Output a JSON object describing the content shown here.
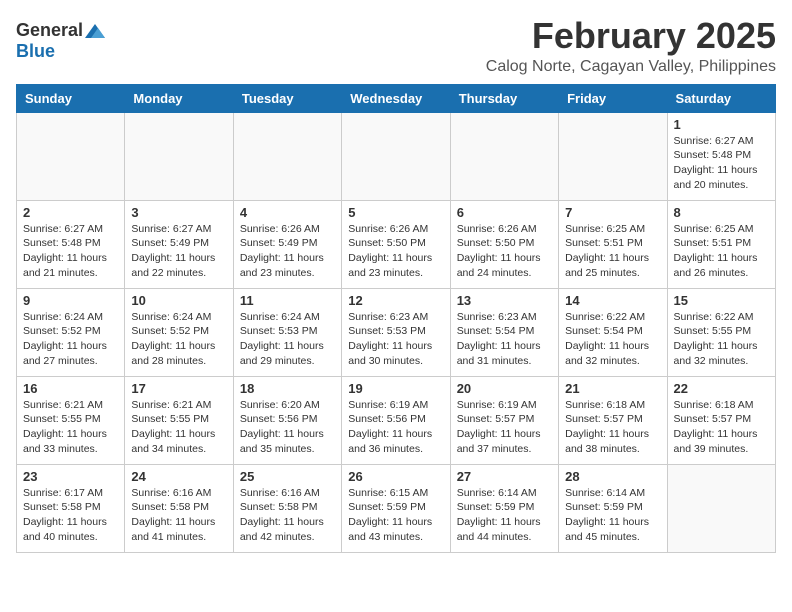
{
  "header": {
    "logo_general": "General",
    "logo_blue": "Blue",
    "month_title": "February 2025",
    "location": "Calog Norte, Cagayan Valley, Philippines"
  },
  "weekdays": [
    "Sunday",
    "Monday",
    "Tuesday",
    "Wednesday",
    "Thursday",
    "Friday",
    "Saturday"
  ],
  "weeks": [
    [
      {
        "day": "",
        "info": ""
      },
      {
        "day": "",
        "info": ""
      },
      {
        "day": "",
        "info": ""
      },
      {
        "day": "",
        "info": ""
      },
      {
        "day": "",
        "info": ""
      },
      {
        "day": "",
        "info": ""
      },
      {
        "day": "1",
        "info": "Sunrise: 6:27 AM\nSunset: 5:48 PM\nDaylight: 11 hours and 20 minutes."
      }
    ],
    [
      {
        "day": "2",
        "info": "Sunrise: 6:27 AM\nSunset: 5:48 PM\nDaylight: 11 hours and 21 minutes."
      },
      {
        "day": "3",
        "info": "Sunrise: 6:27 AM\nSunset: 5:49 PM\nDaylight: 11 hours and 22 minutes."
      },
      {
        "day": "4",
        "info": "Sunrise: 6:26 AM\nSunset: 5:49 PM\nDaylight: 11 hours and 23 minutes."
      },
      {
        "day": "5",
        "info": "Sunrise: 6:26 AM\nSunset: 5:50 PM\nDaylight: 11 hours and 23 minutes."
      },
      {
        "day": "6",
        "info": "Sunrise: 6:26 AM\nSunset: 5:50 PM\nDaylight: 11 hours and 24 minutes."
      },
      {
        "day": "7",
        "info": "Sunrise: 6:25 AM\nSunset: 5:51 PM\nDaylight: 11 hours and 25 minutes."
      },
      {
        "day": "8",
        "info": "Sunrise: 6:25 AM\nSunset: 5:51 PM\nDaylight: 11 hours and 26 minutes."
      }
    ],
    [
      {
        "day": "9",
        "info": "Sunrise: 6:24 AM\nSunset: 5:52 PM\nDaylight: 11 hours and 27 minutes."
      },
      {
        "day": "10",
        "info": "Sunrise: 6:24 AM\nSunset: 5:52 PM\nDaylight: 11 hours and 28 minutes."
      },
      {
        "day": "11",
        "info": "Sunrise: 6:24 AM\nSunset: 5:53 PM\nDaylight: 11 hours and 29 minutes."
      },
      {
        "day": "12",
        "info": "Sunrise: 6:23 AM\nSunset: 5:53 PM\nDaylight: 11 hours and 30 minutes."
      },
      {
        "day": "13",
        "info": "Sunrise: 6:23 AM\nSunset: 5:54 PM\nDaylight: 11 hours and 31 minutes."
      },
      {
        "day": "14",
        "info": "Sunrise: 6:22 AM\nSunset: 5:54 PM\nDaylight: 11 hours and 32 minutes."
      },
      {
        "day": "15",
        "info": "Sunrise: 6:22 AM\nSunset: 5:55 PM\nDaylight: 11 hours and 32 minutes."
      }
    ],
    [
      {
        "day": "16",
        "info": "Sunrise: 6:21 AM\nSunset: 5:55 PM\nDaylight: 11 hours and 33 minutes."
      },
      {
        "day": "17",
        "info": "Sunrise: 6:21 AM\nSunset: 5:55 PM\nDaylight: 11 hours and 34 minutes."
      },
      {
        "day": "18",
        "info": "Sunrise: 6:20 AM\nSunset: 5:56 PM\nDaylight: 11 hours and 35 minutes."
      },
      {
        "day": "19",
        "info": "Sunrise: 6:19 AM\nSunset: 5:56 PM\nDaylight: 11 hours and 36 minutes."
      },
      {
        "day": "20",
        "info": "Sunrise: 6:19 AM\nSunset: 5:57 PM\nDaylight: 11 hours and 37 minutes."
      },
      {
        "day": "21",
        "info": "Sunrise: 6:18 AM\nSunset: 5:57 PM\nDaylight: 11 hours and 38 minutes."
      },
      {
        "day": "22",
        "info": "Sunrise: 6:18 AM\nSunset: 5:57 PM\nDaylight: 11 hours and 39 minutes."
      }
    ],
    [
      {
        "day": "23",
        "info": "Sunrise: 6:17 AM\nSunset: 5:58 PM\nDaylight: 11 hours and 40 minutes."
      },
      {
        "day": "24",
        "info": "Sunrise: 6:16 AM\nSunset: 5:58 PM\nDaylight: 11 hours and 41 minutes."
      },
      {
        "day": "25",
        "info": "Sunrise: 6:16 AM\nSunset: 5:58 PM\nDaylight: 11 hours and 42 minutes."
      },
      {
        "day": "26",
        "info": "Sunrise: 6:15 AM\nSunset: 5:59 PM\nDaylight: 11 hours and 43 minutes."
      },
      {
        "day": "27",
        "info": "Sunrise: 6:14 AM\nSunset: 5:59 PM\nDaylight: 11 hours and 44 minutes."
      },
      {
        "day": "28",
        "info": "Sunrise: 6:14 AM\nSunset: 5:59 PM\nDaylight: 11 hours and 45 minutes."
      },
      {
        "day": "",
        "info": ""
      }
    ]
  ]
}
